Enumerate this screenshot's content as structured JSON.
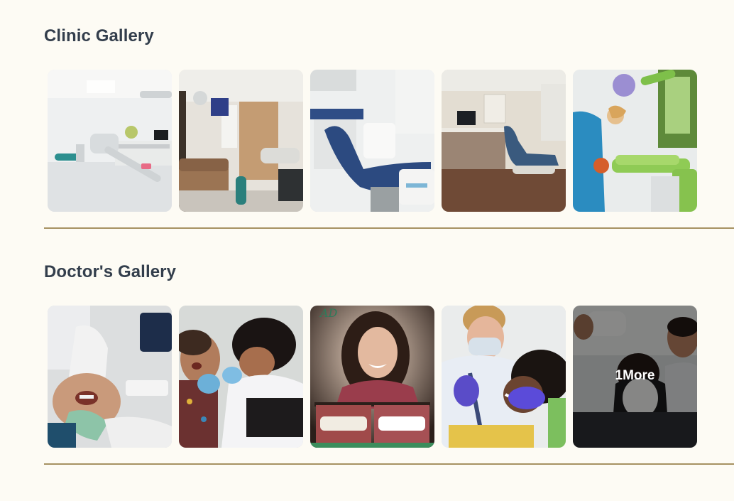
{
  "clinic_gallery": {
    "title": "Clinic Gallery",
    "images": [
      {
        "subject": "white dental clinic room with dental chair and cabinets",
        "icon": "clinic-room-icon"
      },
      {
        "subject": "dental clinic with brown sofa and dental chair",
        "icon": "clinic-waiting-icon"
      },
      {
        "subject": "navy blue dental chair with white unit",
        "icon": "dental-chair-icon"
      },
      {
        "subject": "dental room with wooden floor, monitor and blue chair",
        "icon": "dental-room-icon"
      },
      {
        "subject": "dentist treating patient in green dental chair",
        "icon": "dentist-patient-icon"
      }
    ]
  },
  "doctors_gallery": {
    "title": "Doctor's Gallery",
    "images": [
      {
        "subject": "patient with open mouth during dental exam",
        "icon": "dental-exam-icon"
      },
      {
        "subject": "doctor examining a child's teeth",
        "icon": "child-exam-icon"
      },
      {
        "subject": "smiling woman with before and after teeth comparison",
        "icon": "before-after-icon"
      },
      {
        "subject": "dentist with mask examining smiling woman",
        "icon": "dentist-mask-icon"
      },
      {
        "subject": "patient in dental chair with smiling doctor",
        "icon": "patient-chair-icon",
        "overlay_label": "1More"
      }
    ]
  },
  "colors": {
    "background": "#fdfbf4",
    "heading": "#333e4c",
    "divider": "#a69262",
    "overlay_text": "#ffffff"
  }
}
